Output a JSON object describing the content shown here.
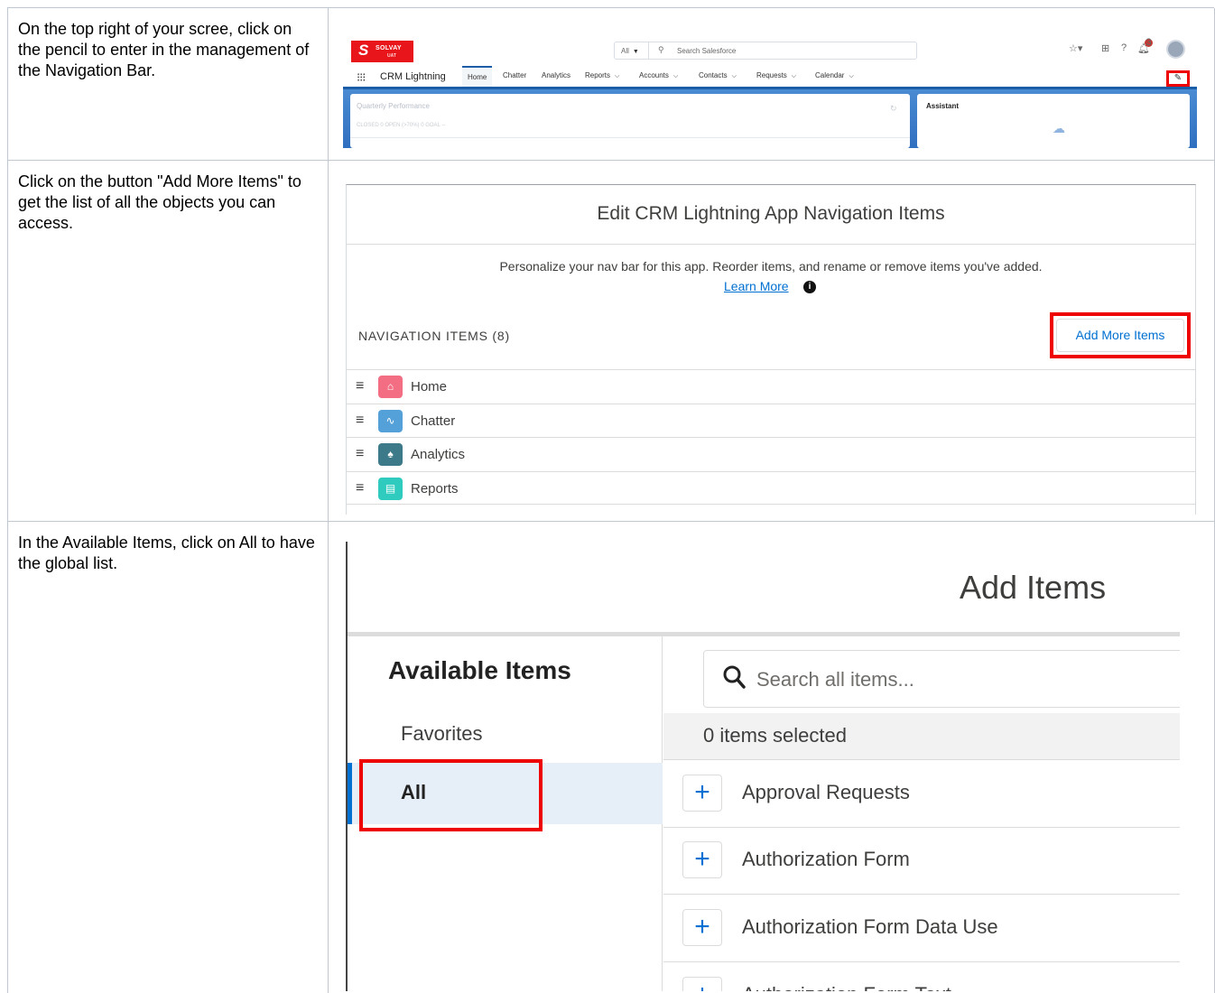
{
  "steps": [
    {
      "instruction": "On the top right of your scree, click on the pencil to enter in the management of the Navigation Bar."
    },
    {
      "instruction": "Click on the button \"Add More Items\" to get the list of all the objects you can access."
    },
    {
      "instruction": "In the Available Items, click on All to have the global list."
    }
  ],
  "shot1": {
    "logo_text": "SOLVAY",
    "logo_sub": "UAT",
    "search_scope": "All",
    "search_placeholder": "Search Salesforce",
    "notification_count": "3",
    "app_name": "CRM Lightning",
    "tabs": [
      {
        "label": "Home"
      },
      {
        "label": "Chatter"
      },
      {
        "label": "Analytics"
      },
      {
        "label": "Reports"
      },
      {
        "label": "Accounts"
      },
      {
        "label": "Contacts"
      },
      {
        "label": "Requests"
      },
      {
        "label": "Calendar"
      }
    ],
    "card_quarterly_title": "Quarterly Performance",
    "card_quarterly_stats": "CLOSED  0     OPEN (>70%)  0     GOAL  --",
    "card_assistant_title": "Assistant"
  },
  "shot2": {
    "title": "Edit CRM Lightning App Navigation Items",
    "description": "Personalize your nav bar for this app. Reorder items, and rename or remove items you've added.",
    "learn_more": "Learn More",
    "nav_items_heading": "NAVIGATION ITEMS (8)",
    "add_more_items": "Add More Items",
    "items": [
      {
        "label": "Home",
        "color": "#f36e83"
      },
      {
        "label": "Chatter",
        "color": "#54a0d8"
      },
      {
        "label": "Analytics",
        "color": "#3c7a8a"
      },
      {
        "label": "Reports",
        "color": "#2ecbbe"
      }
    ]
  },
  "shot3": {
    "title": "Add Items",
    "available_items": "Available Items",
    "favorites": "Favorites",
    "all": "All",
    "search_placeholder": "Search all items...",
    "selected_count": "0 items selected",
    "items": [
      {
        "label": "Approval Requests"
      },
      {
        "label": "Authorization Form"
      },
      {
        "label": "Authorization Form Data Use"
      },
      {
        "label": "Authorization Form Text"
      }
    ]
  },
  "colors": {
    "highlight": "#ee0000",
    "link": "#0070d2",
    "brand": "#e8161b"
  }
}
